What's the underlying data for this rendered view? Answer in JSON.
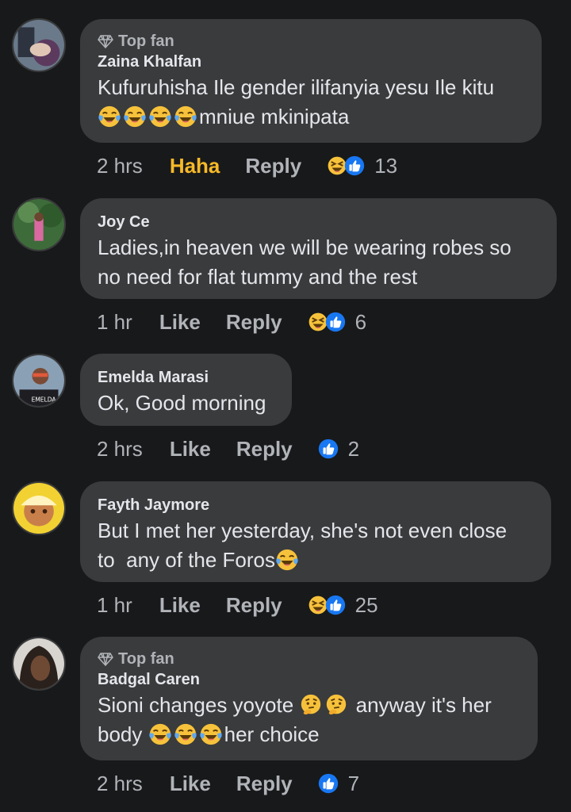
{
  "colors": {
    "background": "#18191a",
    "bubble": "#3a3b3c",
    "haha_active": "#f7b928",
    "like_blue": "#1877f2",
    "emoji_yellow": "#f7c23b"
  },
  "comments": [
    {
      "top_fan": "Top fan",
      "author": "Zaina Khalfan",
      "text_line1": "Kufuruhisha Ile gender ilifanyia yesu Ile kitu",
      "text_line2_suffix": "mniue mkinipata",
      "time": "2 hrs",
      "reaction_action": "Haha",
      "reply": "Reply",
      "count": "13",
      "reaction_icons": [
        "haha-icon",
        "like-icon"
      ]
    },
    {
      "author": "Joy Ce",
      "text_line1": "Ladies,in heaven we will be wearing robes so",
      "text_line2": "no need for flat tummy and the rest",
      "time": "1 hr",
      "reaction_action": "Like",
      "reply": "Reply",
      "count": "6",
      "reaction_icons": [
        "haha-icon",
        "like-icon"
      ]
    },
    {
      "author": "Emelda Marasi",
      "text_line1": "Ok, Good morning",
      "time": "2 hrs",
      "reaction_action": "Like",
      "reply": "Reply",
      "count": "2",
      "reaction_icons": [
        "like-icon"
      ]
    },
    {
      "author": "Fayth Jaymore",
      "text_line1": "But I met her yesterday, she's not even close",
      "text_line2": "to  any of the Foros",
      "time": "1 hr",
      "reaction_action": "Like",
      "reply": "Reply",
      "count": "25",
      "reaction_icons": [
        "haha-icon",
        "like-icon"
      ]
    },
    {
      "top_fan": "Top fan",
      "author": "Badgal Caren",
      "text_line1_a": "Sioni changes yoyote ",
      "text_line1_b": " anyway it's her",
      "text_line2_a": "body ",
      "text_line2_b": "her choice",
      "time": "2 hrs",
      "reaction_action": "Like",
      "reply": "Reply",
      "count": "7",
      "reaction_icons": [
        "like-icon"
      ]
    }
  ]
}
